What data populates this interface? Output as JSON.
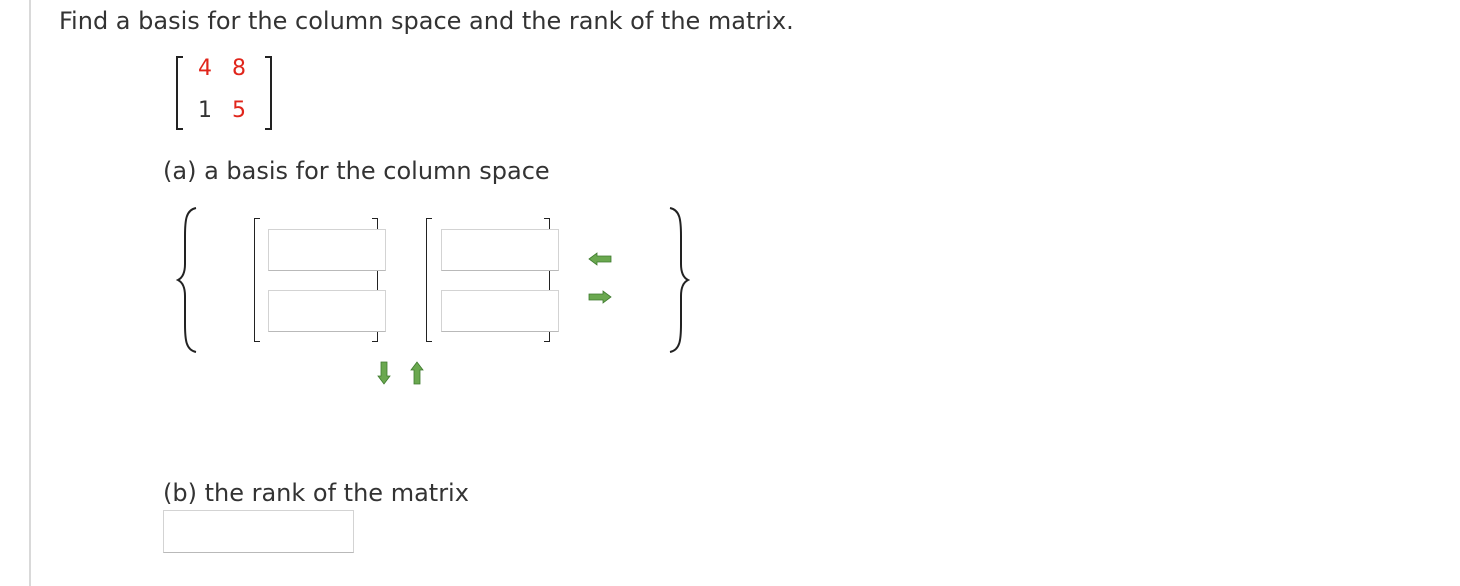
{
  "question": {
    "text": "Find a basis for the column space and the rank of the matrix."
  },
  "matrix": {
    "rows": [
      [
        "4",
        "8"
      ],
      [
        "1",
        "5"
      ]
    ],
    "colors": [
      [
        "red",
        "red"
      ],
      [
        "dark",
        "red"
      ]
    ]
  },
  "part_a": {
    "label": "(a) a basis for the column space",
    "vectors": [
      {
        "entries": [
          "",
          ""
        ]
      },
      {
        "entries": [
          "",
          ""
        ]
      }
    ]
  },
  "part_b": {
    "label": "(b) the rank of the matrix",
    "value": ""
  },
  "controls": {
    "remove_vector_icon": "arrow-left-icon",
    "add_vector_icon": "arrow-right-icon",
    "add_row_icon": "arrow-down-icon",
    "remove_row_icon": "arrow-up-icon",
    "arrow_color": "#6aa84f"
  },
  "colors": {
    "red": "#e0251b",
    "text": "#333333"
  }
}
